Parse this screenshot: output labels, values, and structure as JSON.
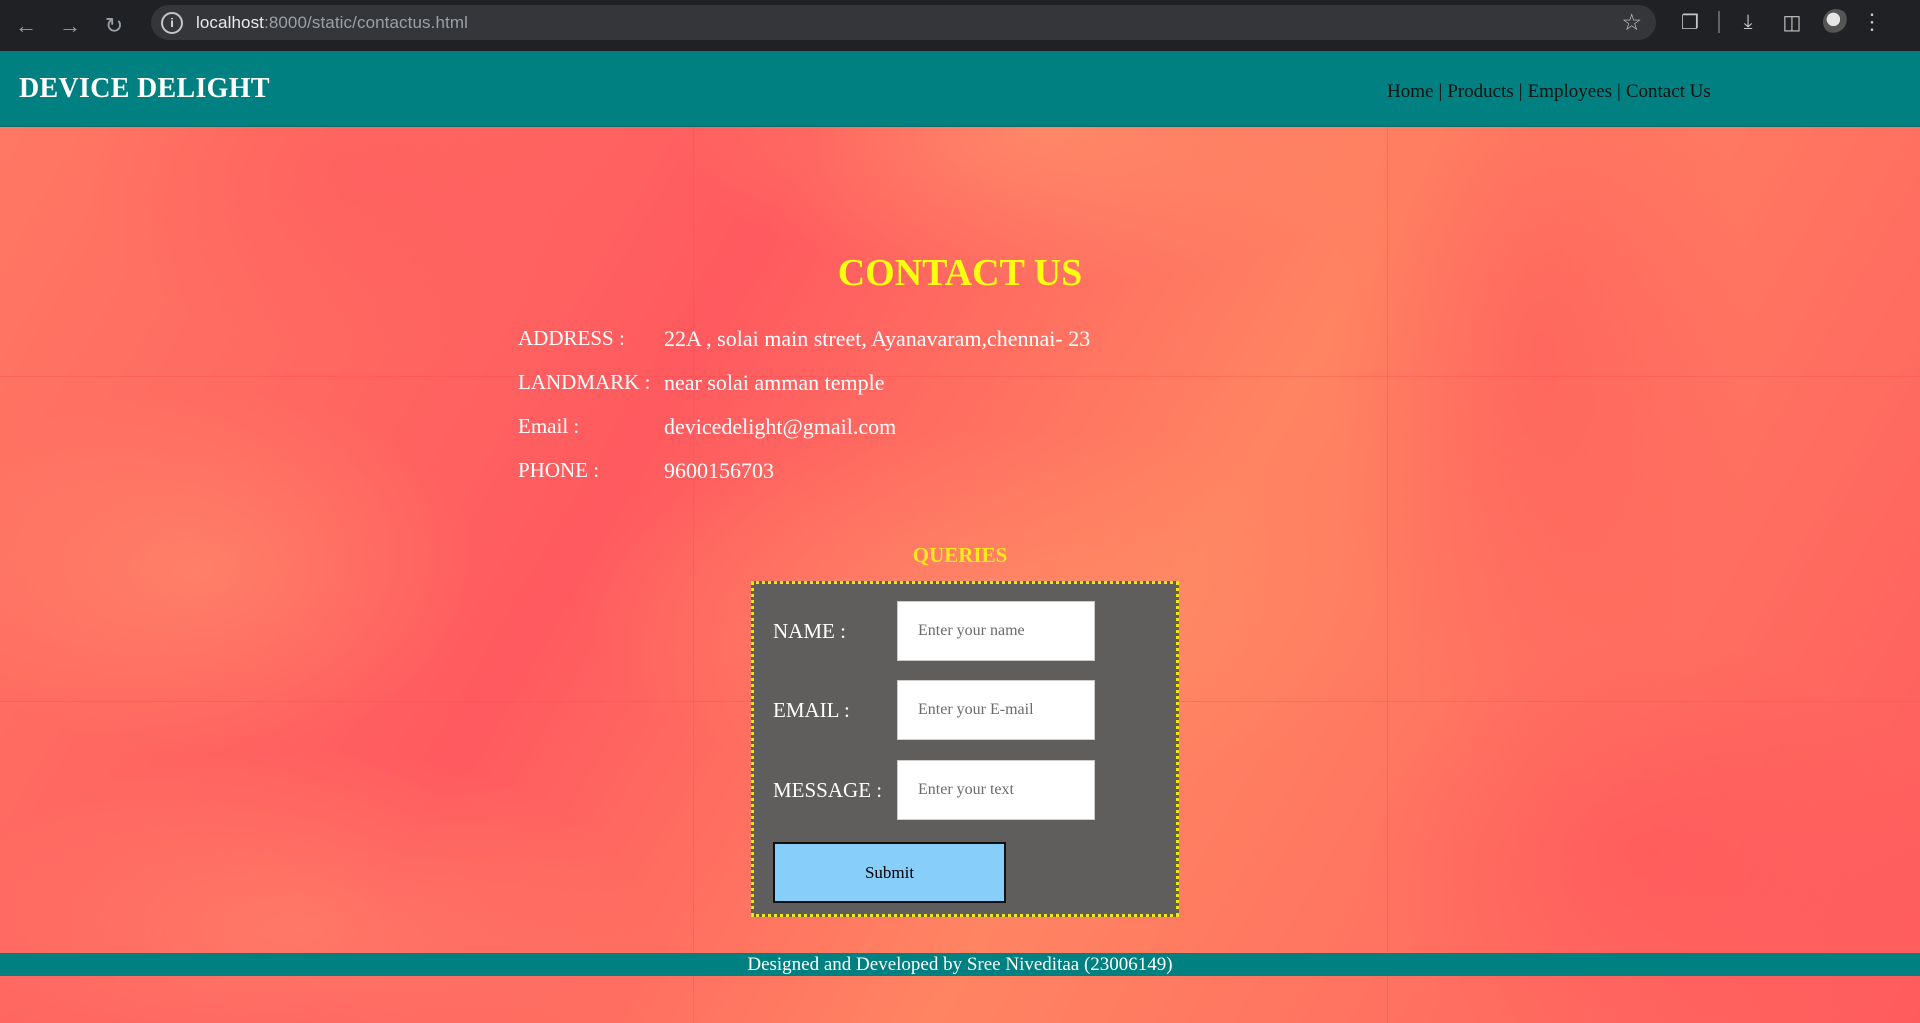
{
  "browser": {
    "back_icon": "arrow-left-icon",
    "forward_icon": "arrow-right-icon",
    "reload_icon": "reload-icon",
    "url_host": "localhost",
    "url_rest": ":8000/static/contactus.html",
    "bookmark_icon": "star-icon",
    "extensions_icon": "puzzle-icon",
    "download_icon": "download-icon",
    "sidepanel_icon": "side-panel-icon",
    "menu_icon": "three-dots-icon"
  },
  "header": {
    "brand": "DEVICE DELIGHT",
    "nav": [
      "Home",
      "Products",
      "Employees",
      "Contact Us"
    ],
    "separator": "|",
    "bg_color": "#008080"
  },
  "contact": {
    "title": "CONTACT US",
    "rows": [
      {
        "label": "ADDRESS :",
        "value": "22A , solai main street, Ayanavaram,chennai- 23"
      },
      {
        "label": "LANDMARK :",
        "value": "near solai amman temple"
      },
      {
        "label": "Email :",
        "value": "devicedelight@gmail.com"
      },
      {
        "label": "PHONE :",
        "value": "9600156703"
      }
    ],
    "title_color": "#ffff10"
  },
  "queries": {
    "heading": "QUERIES",
    "name_label": "NAME :",
    "name_placeholder": "Enter your name",
    "email_label": "EMAIL :",
    "email_placeholder": "Enter your E-mail",
    "message_label": "MESSAGE :",
    "message_placeholder": "Enter your text",
    "submit_label": "Submit",
    "submit_color": "#87cefa",
    "box_color": "#5f5e5c"
  },
  "footer": {
    "text": "Designed and Developed by Sree Niveditaa (23006149)"
  }
}
